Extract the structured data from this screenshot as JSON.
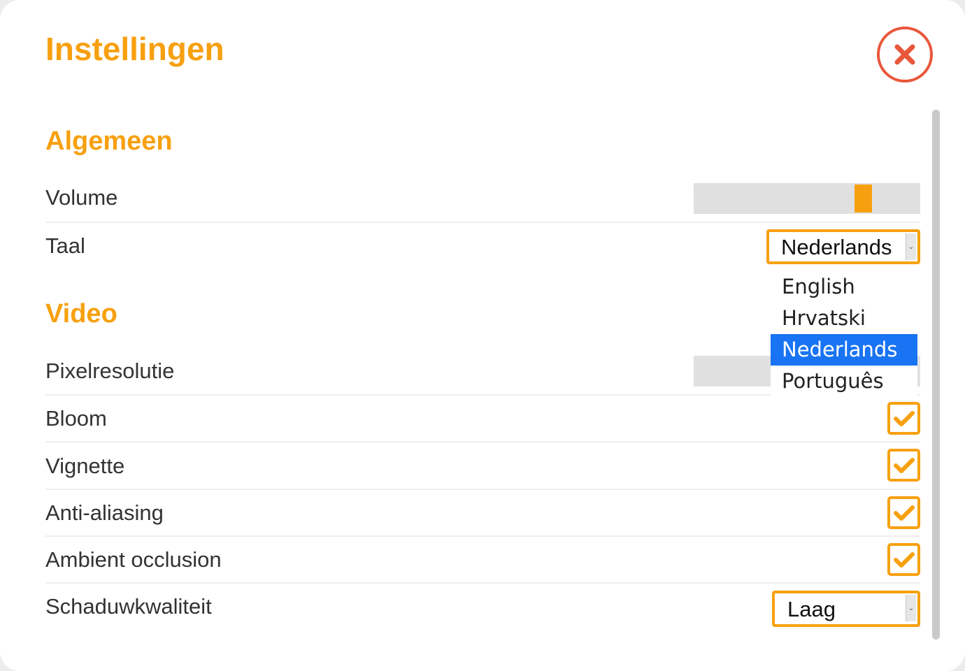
{
  "dialog": {
    "title": "Instellingen",
    "close_icon": "close-icon"
  },
  "colors": {
    "accent": "#f7a00f",
    "close": "#e9573b",
    "selection": "#1874f2"
  },
  "sections": {
    "general": {
      "title": "Algemeen",
      "volume": {
        "label": "Volume",
        "level": 0.77
      },
      "language": {
        "label": "Taal",
        "value": "Nederlands",
        "options": [
          "English",
          "Hrvatski",
          "Nederlands",
          "Português"
        ],
        "highlighted": "Nederlands"
      }
    },
    "video": {
      "title": "Video",
      "pixel_resolution": {
        "label": "Pixelresolutie"
      },
      "bloom": {
        "label": "Bloom",
        "checked": true
      },
      "vignette": {
        "label": "Vignette",
        "checked": true
      },
      "anti_aliasing": {
        "label": "Anti-aliasing",
        "checked": true
      },
      "ambient_occlusion": {
        "label": "Ambient occlusion",
        "checked": true
      },
      "shadow_quality": {
        "label": "Schaduwkwaliteit",
        "value": "Laag"
      }
    }
  }
}
